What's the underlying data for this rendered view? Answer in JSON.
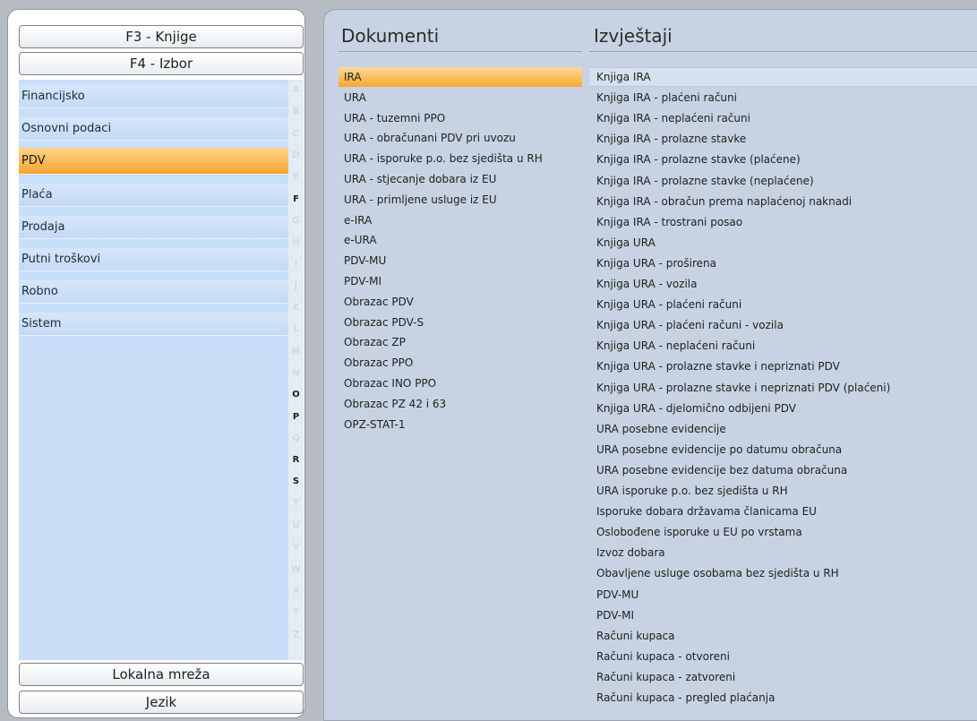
{
  "buttons": {
    "f3": "F3 - Knjige",
    "f4": "F4 - Izbor",
    "lan": "Lokalna mreža",
    "lang": "Jezik"
  },
  "modules": [
    {
      "label": "Financijsko",
      "selected": false
    },
    {
      "label": "Osnovni podaci",
      "selected": false
    },
    {
      "label": "PDV",
      "selected": true
    },
    {
      "label": "Plaća",
      "selected": false
    },
    {
      "label": "Prodaja",
      "selected": false
    },
    {
      "label": "Putni troškovi",
      "selected": false
    },
    {
      "label": "Robno",
      "selected": false
    },
    {
      "label": "Sistem",
      "selected": false
    }
  ],
  "alphabet": [
    {
      "letter": "A",
      "active": false
    },
    {
      "letter": "B",
      "active": false
    },
    {
      "letter": "C",
      "active": false
    },
    {
      "letter": "D",
      "active": false
    },
    {
      "letter": "E",
      "active": false
    },
    {
      "letter": "F",
      "active": true
    },
    {
      "letter": "G",
      "active": false
    },
    {
      "letter": "H",
      "active": false
    },
    {
      "letter": "I",
      "active": false
    },
    {
      "letter": "J",
      "active": false
    },
    {
      "letter": "K",
      "active": false
    },
    {
      "letter": "L",
      "active": false
    },
    {
      "letter": "M",
      "active": false
    },
    {
      "letter": "N",
      "active": false
    },
    {
      "letter": "O",
      "active": true
    },
    {
      "letter": "P",
      "active": true
    },
    {
      "letter": "Q",
      "active": false
    },
    {
      "letter": "R",
      "active": true
    },
    {
      "letter": "S",
      "active": true
    },
    {
      "letter": "T",
      "active": false
    },
    {
      "letter": "U",
      "active": false
    },
    {
      "letter": "V",
      "active": false
    },
    {
      "letter": "W",
      "active": false
    },
    {
      "letter": "X",
      "active": false
    },
    {
      "letter": "Y",
      "active": false
    },
    {
      "letter": "Z",
      "active": false
    }
  ],
  "documents": {
    "title": "Dokumenti",
    "items": [
      {
        "label": "IRA",
        "selected": true
      },
      {
        "label": "URA",
        "selected": false
      },
      {
        "label": "URA - tuzemni PPO",
        "selected": false
      },
      {
        "label": "URA - obračunani PDV pri uvozu",
        "selected": false
      },
      {
        "label": "URA - isporuke p.o. bez sjedišta u RH",
        "selected": false
      },
      {
        "label": "URA - stjecanje dobara iz EU",
        "selected": false
      },
      {
        "label": "URA - primljene usluge iz EU",
        "selected": false
      },
      {
        "label": "e-IRA",
        "selected": false
      },
      {
        "label": "e-URA",
        "selected": false
      },
      {
        "label": "PDV-MU",
        "selected": false
      },
      {
        "label": "PDV-MI",
        "selected": false
      },
      {
        "label": "Obrazac PDV",
        "selected": false
      },
      {
        "label": "Obrazac PDV-S",
        "selected": false
      },
      {
        "label": "Obrazac ZP",
        "selected": false
      },
      {
        "label": "Obrazac PPO",
        "selected": false
      },
      {
        "label": "Obrazac INO PPO",
        "selected": false
      },
      {
        "label": "Obrazac PZ 42 i 63",
        "selected": false
      },
      {
        "label": "OPZ-STAT-1",
        "selected": false
      }
    ]
  },
  "reports": {
    "title": "Izvještaji",
    "items": [
      {
        "label": "Knjiga IRA",
        "selected": true
      },
      {
        "label": "Knjiga IRA - plaćeni računi",
        "selected": false
      },
      {
        "label": "Knjiga IRA - neplaćeni računi",
        "selected": false
      },
      {
        "label": "Knjiga IRA - prolazne stavke",
        "selected": false
      },
      {
        "label": "Knjiga IRA - prolazne stavke (plaćene)",
        "selected": false
      },
      {
        "label": "Knjiga IRA - prolazne stavke (neplaćene)",
        "selected": false
      },
      {
        "label": "Knjiga IRA - obračun prema naplaćenoj naknadi",
        "selected": false
      },
      {
        "label": "Knjiga IRA - trostrani posao",
        "selected": false
      },
      {
        "label": "Knjiga URA",
        "selected": false
      },
      {
        "label": "Knjiga URA - proširena",
        "selected": false
      },
      {
        "label": "Knjiga URA - vozila",
        "selected": false
      },
      {
        "label": "Knjiga URA - plaćeni računi",
        "selected": false
      },
      {
        "label": "Knjiga URA - plaćeni računi - vozila",
        "selected": false
      },
      {
        "label": "Knjiga URA - neplaćeni računi",
        "selected": false
      },
      {
        "label": "Knjiga URA - prolazne stavke i nepriznati PDV",
        "selected": false
      },
      {
        "label": "Knjiga URA - prolazne stavke i nepriznati PDV (plaćeni)",
        "selected": false
      },
      {
        "label": "Knjiga URA - djelomično odbijeni PDV",
        "selected": false
      },
      {
        "label": "URA posebne evidencije",
        "selected": false
      },
      {
        "label": "URA posebne evidencije po datumu obračuna",
        "selected": false
      },
      {
        "label": "URA posebne evidencije bez datuma obračuna",
        "selected": false
      },
      {
        "label": "URA isporuke p.o. bez sjedišta u RH",
        "selected": false
      },
      {
        "label": "Isporuke dobara državama članicama EU",
        "selected": false
      },
      {
        "label": "Oslobođene isporuke u EU po vrstama",
        "selected": false
      },
      {
        "label": "Izvoz dobara",
        "selected": false
      },
      {
        "label": "Obavljene usluge osobama bez sjedišta u RH",
        "selected": false
      },
      {
        "label": "PDV-MU",
        "selected": false
      },
      {
        "label": "PDV-MI",
        "selected": false
      },
      {
        "label": "Računi kupaca",
        "selected": false
      },
      {
        "label": "Računi kupaca - otvoreni",
        "selected": false
      },
      {
        "label": "Računi kupaca - zatvoreni",
        "selected": false
      },
      {
        "label": "Računi kupaca - pregled plaćanja",
        "selected": false
      }
    ]
  }
}
